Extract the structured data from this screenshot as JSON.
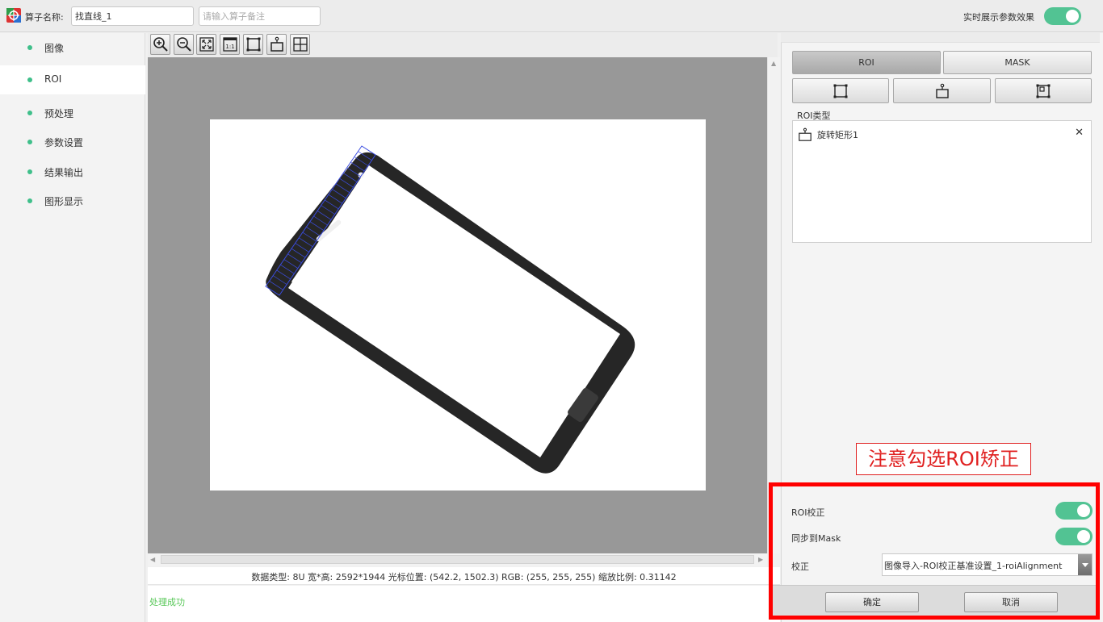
{
  "header": {
    "name_label": "算子名称:",
    "name_value": "找直线_1",
    "note_placeholder": "请输入算子备注",
    "realtime_label": "实时展示参数效果",
    "realtime_on": true
  },
  "sidebar": {
    "items": [
      {
        "label": "图像",
        "active": false
      },
      {
        "label": "ROI",
        "active": true
      },
      {
        "label": "预处理",
        "active": false
      },
      {
        "label": "参数设置",
        "active": false
      },
      {
        "label": "结果输出",
        "active": false
      },
      {
        "label": "图形显示",
        "active": false
      }
    ]
  },
  "toolbar": {
    "icons": [
      "zoom-in-icon",
      "zoom-out-icon",
      "fit-window-icon",
      "actual-size-icon",
      "rectangle-icon",
      "rotated-rectangle-icon",
      "crosshair-icon"
    ],
    "actual_size_text": "1:1"
  },
  "status": {
    "info": "数据类型: 8U 宽*高: 2592*1944 光标位置: (542.2, 1502.3) RGB: (255, 255, 255) 缩放比例: 0.31142",
    "log": "处理成功"
  },
  "right_panel": {
    "tabs": [
      {
        "label": "ROI",
        "active": true
      },
      {
        "label": "MASK",
        "active": false
      }
    ],
    "shape_buttons": [
      "rectangle-icon",
      "rotated-rectangle-icon",
      "multi-rectangle-icon"
    ],
    "roi_type_label": "ROI类型",
    "roi_items": [
      {
        "label": "旋转矩形1",
        "icon": "rotated-rectangle-icon"
      }
    ],
    "annotation": "注意勾选ROI矫正",
    "options": {
      "roi_correction_label": "ROI校正",
      "roi_correction_on": true,
      "sync_mask_label": "同步到Mask",
      "sync_mask_on": true,
      "correction_label": "校正",
      "correction_value": "图像导入-ROI校正基准设置_1-roiAlignment"
    },
    "confirm_label": "确定",
    "cancel_label": "取消"
  },
  "colors": {
    "accent": "#52c393",
    "highlight": "#ff0000",
    "success": "#5ac85a"
  }
}
